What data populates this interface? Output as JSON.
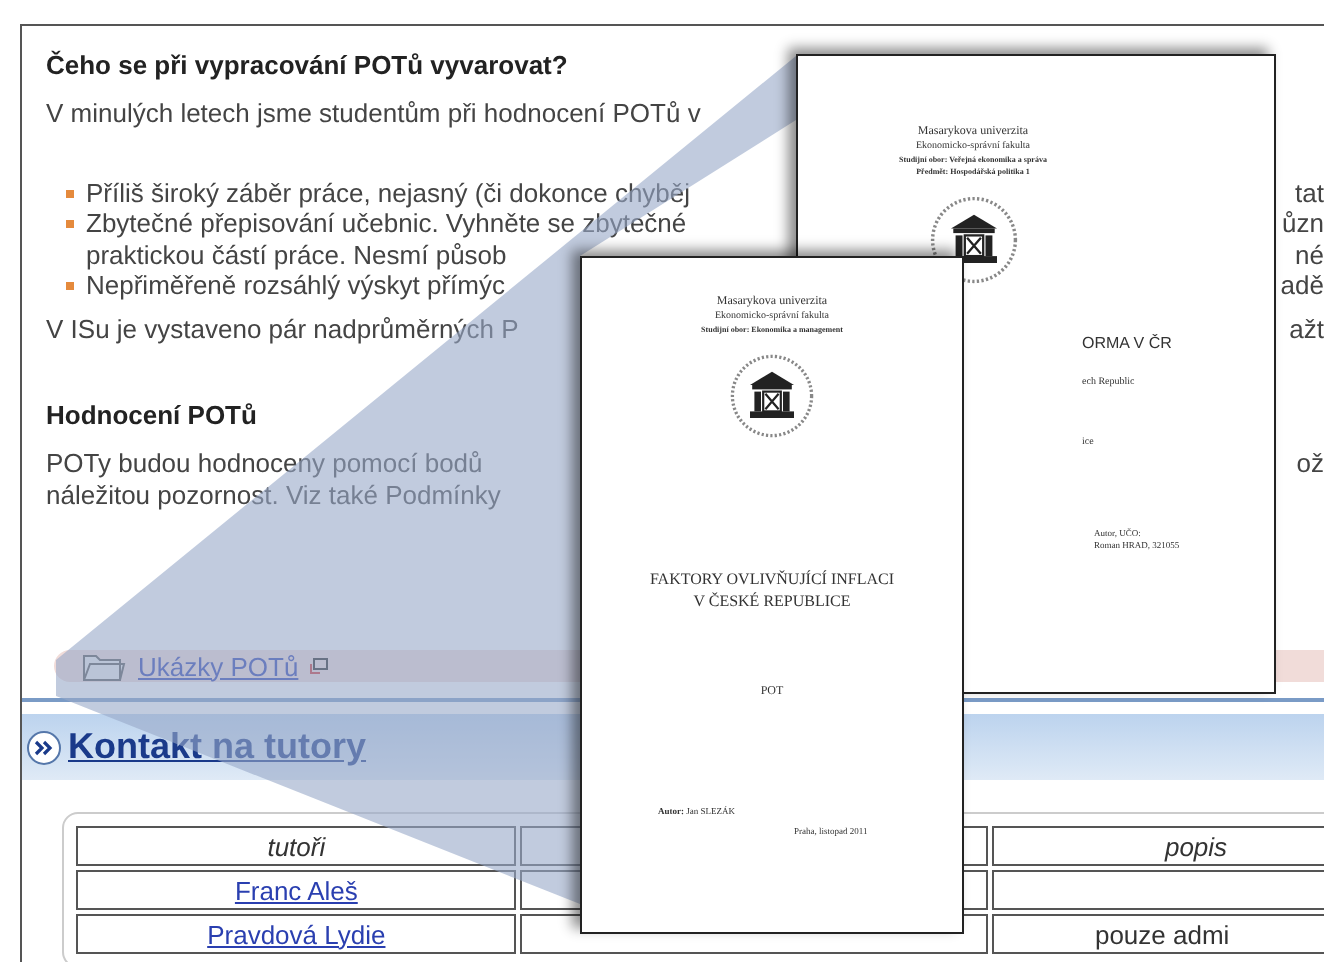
{
  "guide": {
    "heading": "Čeho se při vypracování POTů vyvarovat?",
    "intro": {
      "left": "V minulých letech jsme studentům při hodnocení POTů v"
    },
    "bullets": [
      {
        "lines": [
          {
            "left": "Příliš široký záběr práce, nejasný (či dokonce chyběj",
            "right": "tat"
          }
        ]
      },
      {
        "lines": [
          {
            "left": "Zbytečné přepisování učebnic. Vyhněte se zbytečné",
            "right": "ůzn"
          },
          {
            "left": "praktickou částí práce. Nesmí působ",
            "right": "né"
          }
        ]
      },
      {
        "lines": [
          {
            "left": "Nepřiměřeně rozsáhlý výskyt přímýc",
            "right": "adě"
          }
        ]
      }
    ],
    "note": {
      "left": "V ISu je vystaveno pár nadprůměrných P",
      "right": "ažt"
    }
  },
  "evaluation": {
    "heading": "Hodnocení POTů",
    "lines": [
      {
        "left": "POTy budou hodnoceny pomocí bodů",
        "right": "ož"
      },
      {
        "left": "náležitou pozornost. Viz také Podmínky"
      }
    ]
  },
  "samples_link": "Ukázky POTů",
  "contacts": {
    "title": "Kontakt na tutory",
    "header": {
      "tutor": "tutoři",
      "description": "popis"
    },
    "rows": [
      {
        "tutor": "Franc Aleš"
      },
      {
        "tutor": "Pravdová Lydie",
        "description": "pouze admi"
      }
    ]
  },
  "back_page": {
    "university": "Masarykova univerzita",
    "faculty": "Ekonomicko-správní fakulta",
    "field": "Studijní obor: Veřejná ekonomika a správa",
    "subject": "Předmět: Hospodářská politika 1",
    "title_fragment": "ORMA V ČR",
    "subtitle_fragment": "ech Republic",
    "place_fragment": "ice",
    "author_label": "Autor, UČO:",
    "author": "Roman HRAD, 321055"
  },
  "front_page": {
    "university": "Masarykova univerzita",
    "faculty": "Ekonomicko-správní fakulta",
    "field": "Studijní obor: Ekonomika a management",
    "title_lines": [
      "FAKTORY OVLIVŇUJÍCÍ INFLACI",
      "V ČESKÉ REPUBLICE"
    ],
    "type": "POT",
    "author": "**Autor:** Jan SLEZÁK",
    "place_date": "Praha, listopad 2011"
  }
}
